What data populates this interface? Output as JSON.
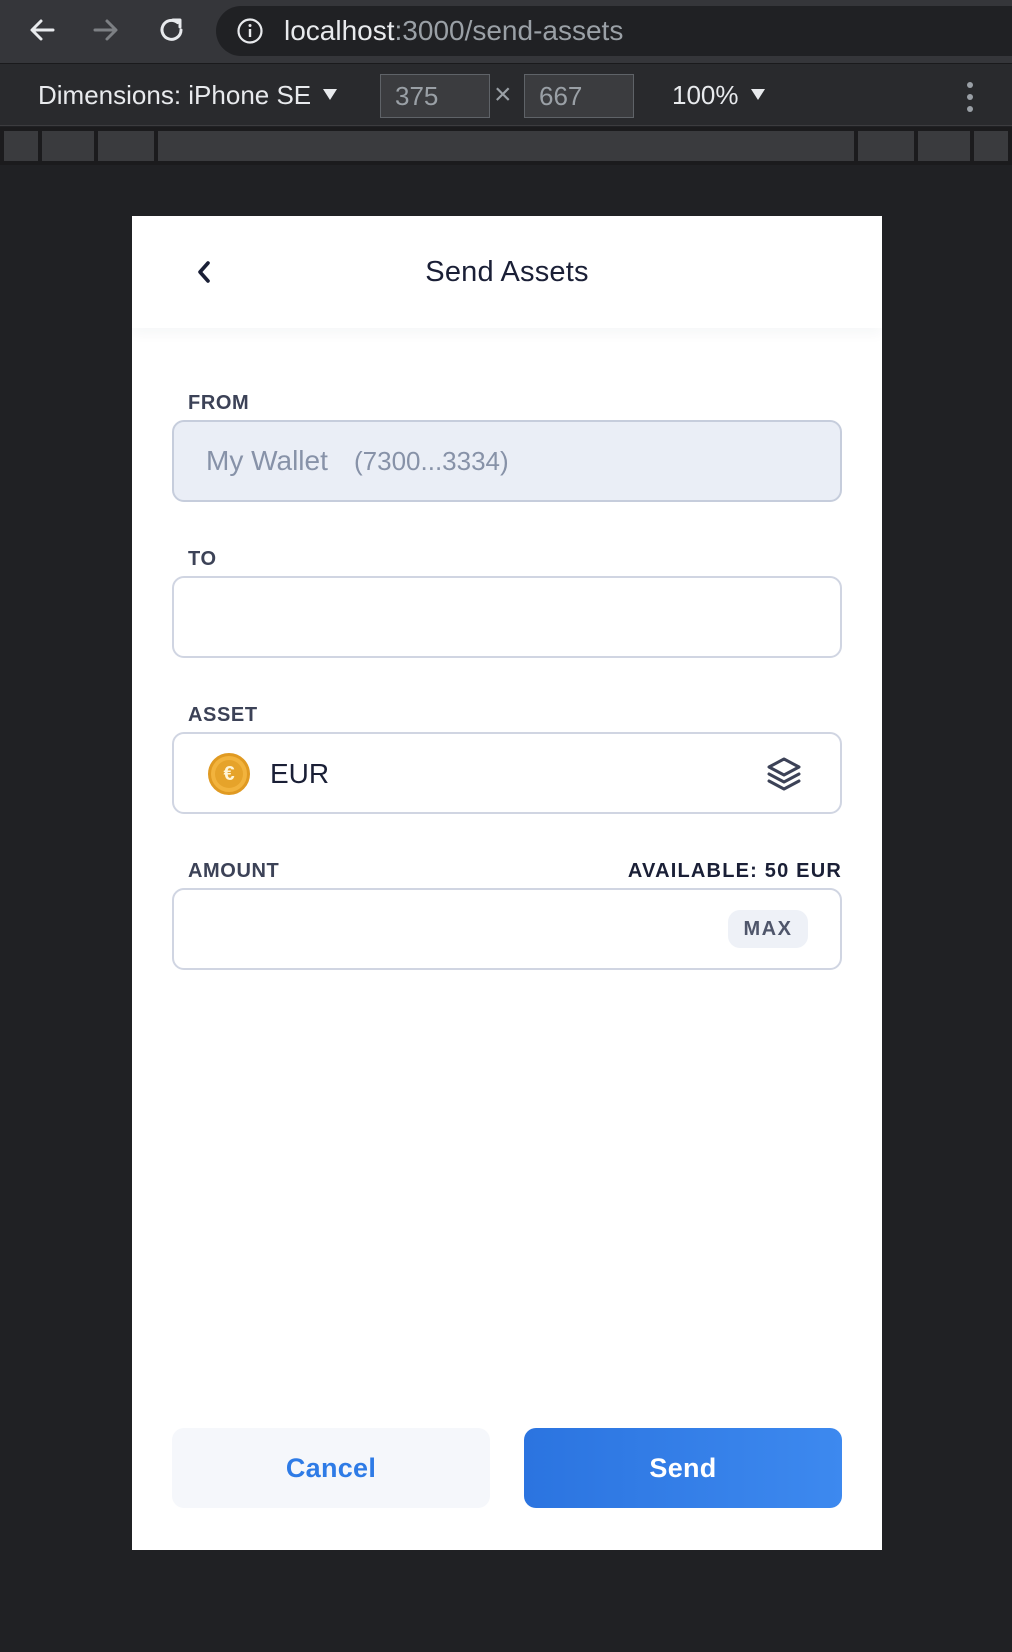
{
  "browser": {
    "url_host": "localhost",
    "url_path": ":3000/send-assets",
    "device_label": "Dimensions: iPhone SE",
    "width_value": "375",
    "height_value": "667",
    "times_symbol": "×",
    "zoom_label": "100%"
  },
  "screen": {
    "title": "Send Assets",
    "from": {
      "label": "FROM",
      "wallet_name": "My Wallet",
      "wallet_address": "(7300...3334)"
    },
    "to": {
      "label": "TO",
      "value": "",
      "placeholder": ""
    },
    "asset": {
      "label": "ASSET",
      "coin_symbol": "€",
      "name": "EUR",
      "selector_icon": "layers-icon"
    },
    "amount": {
      "label": "AMOUNT",
      "available": "AVAILABLE: 50 EUR",
      "value": "",
      "placeholder": "",
      "max_label": "MAX"
    },
    "actions": {
      "cancel_label": "Cancel",
      "send_label": "Send"
    }
  },
  "colors": {
    "accent": "#2e7be6",
    "title": "#1a1f36",
    "label": "#3c4257",
    "coin": "#f2b33d"
  }
}
